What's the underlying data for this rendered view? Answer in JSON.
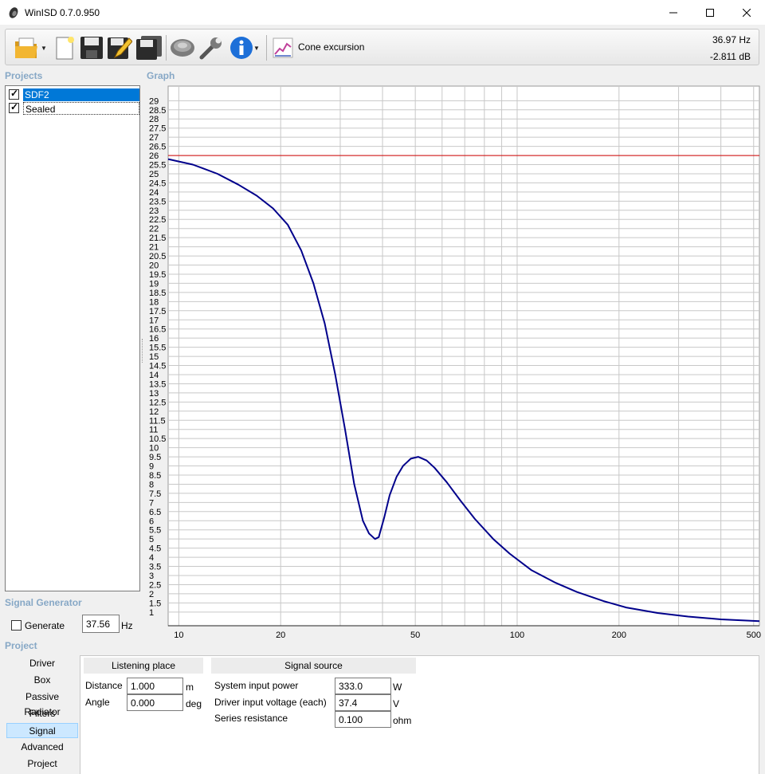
{
  "window": {
    "title": "WinISD 0.7.0.950"
  },
  "toolbar": {
    "open_icon": "folder-open-icon",
    "new_icon": "new-document-icon",
    "save_icon": "floppy-disk-icon",
    "edit_icon": "pencil-edit-icon",
    "save_as_icon": "floppy-disk-multi-icon",
    "driver_icon": "speaker-driver-icon",
    "tools_icon": "wrench-icon",
    "info_icon": "info-icon",
    "graph_type_icon": "line-chart-icon",
    "graph_type_label": "Cone excursion",
    "readout_freq": "36.97 Hz",
    "readout_db": "-2.811 dB"
  },
  "projects": {
    "header": "Projects",
    "items": [
      {
        "label": "SDF2",
        "checked": true
      },
      {
        "label": "Sealed",
        "checked": true
      }
    ]
  },
  "graph": {
    "header": "Graph"
  },
  "signal_generator": {
    "header": "Signal Generator",
    "generate_label": "Generate",
    "frequency": "37.56",
    "unit": "Hz"
  },
  "project_nav": {
    "header": "Project",
    "items": [
      "Driver",
      "Box",
      "Passive Radiator",
      "Filters",
      "Signal",
      "Advanced",
      "Project"
    ],
    "active": "Signal"
  },
  "listening_place": {
    "header": "Listening place",
    "distance_label": "Distance",
    "distance_value": "1.000",
    "distance_unit": "m",
    "angle_label": "Angle",
    "angle_value": "0.000",
    "angle_unit": "deg"
  },
  "signal_source": {
    "header": "Signal source",
    "power_label": "System input power",
    "power_value": "333.0",
    "power_unit": "W",
    "voltage_label": "Driver input voltage (each)",
    "voltage_value": "37.4",
    "voltage_unit": "V",
    "resistance_label": "Series resistance",
    "resistance_value": "0.100",
    "resistance_unit": "ohm"
  },
  "chart_data": {
    "type": "line",
    "xlabel": "",
    "ylabel": "",
    "xscale": "log",
    "xlim": [
      9.3,
      520
    ],
    "ylim": [
      0.25,
      29.8
    ],
    "x_ticks": [
      10,
      20,
      50,
      100,
      200,
      500
    ],
    "y_ticks": [
      1,
      1.5,
      2,
      2.5,
      3,
      3.5,
      4,
      4.5,
      5,
      5.5,
      6,
      6.5,
      7,
      7.5,
      8,
      8.5,
      9,
      9.5,
      10,
      10.5,
      11,
      11.5,
      12,
      12.5,
      13,
      13.5,
      14,
      14.5,
      15,
      15.5,
      16,
      16.5,
      17,
      17.5,
      18,
      18.5,
      19,
      19.5,
      20,
      20.5,
      21,
      21.5,
      22,
      22.5,
      23,
      23.5,
      24,
      24.5,
      25,
      25.5,
      26,
      26.5,
      27,
      27.5,
      28,
      28.5,
      29
    ],
    "grid": true,
    "series": [
      {
        "color": "#00008b",
        "x": [
          9.3,
          11,
          13,
          15,
          17,
          19,
          21,
          23,
          25,
          27,
          29,
          31,
          33,
          35,
          36.5,
          38,
          39,
          40.5,
          42,
          44,
          46,
          48.5,
          51,
          54,
          57,
          62,
          68,
          75,
          85,
          95,
          110,
          130,
          150,
          180,
          210,
          260,
          320,
          400,
          520
        ],
        "y": [
          25.8,
          25.5,
          25.0,
          24.4,
          23.8,
          23.1,
          22.2,
          20.8,
          19.0,
          16.8,
          14.0,
          11.0,
          8.0,
          6.0,
          5.3,
          5.0,
          5.1,
          6.2,
          7.4,
          8.4,
          9.0,
          9.4,
          9.5,
          9.3,
          8.9,
          8.1,
          7.1,
          6.1,
          5.0,
          4.2,
          3.3,
          2.6,
          2.1,
          1.6,
          1.25,
          0.95,
          0.75,
          0.6,
          0.5
        ]
      },
      {
        "color": "#d00000",
        "x": [
          9.3,
          520
        ],
        "y": [
          26.0,
          26.0
        ]
      }
    ]
  }
}
